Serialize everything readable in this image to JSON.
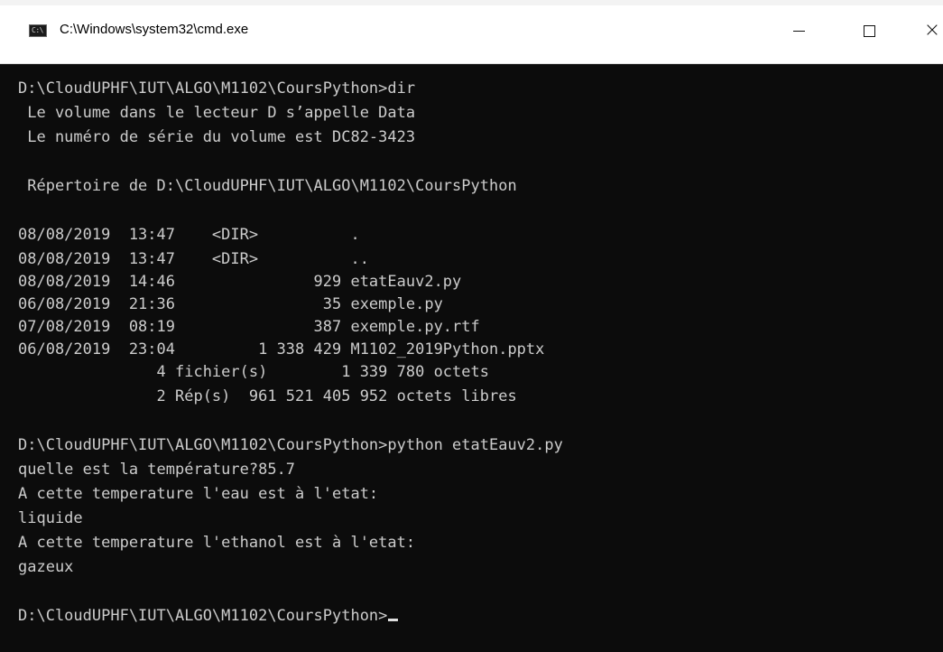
{
  "window": {
    "icon_text": "C:\\",
    "title": "C:\\Windows\\system32\\cmd.exe",
    "minimize_symbol": "",
    "maximize_symbol": "",
    "close_symbol": "×"
  },
  "console": {
    "lines": [
      "D:\\CloudUPHF\\IUT\\ALGO\\M1102\\CoursPython>dir",
      " Le volume dans le lecteur D s’appelle Data",
      " Le numéro de série du volume est DC82-3423",
      "",
      " Répertoire de D:\\CloudUPHF\\IUT\\ALGO\\M1102\\CoursPython",
      "",
      "08/08/2019  13:47    <DIR>          .",
      "08/08/2019  13:47    <DIR>          ..",
      "08/08/2019  14:46               929 etatEauv2.py",
      "06/08/2019  21:36                35 exemple.py",
      "07/08/2019  08:19               387 exemple.py.rtf",
      "06/08/2019  23:04         1 338 429 M1102_2019Python.pptx",
      "               4 fichier(s)        1 339 780 octets",
      "               2 Rép(s)  961 521 405 952 octets libres",
      "",
      "D:\\CloudUPHF\\IUT\\ALGO\\M1102\\CoursPython>python etatEauv2.py",
      "quelle est la température?85.7",
      "A cette temperature l'eau est à l'etat:",
      "liquide",
      "A cette temperature l'ethanol est à l'etat:",
      "gazeux",
      "",
      "D:\\CloudUPHF\\IUT\\ALGO\\M1102\\CoursPython>"
    ]
  }
}
